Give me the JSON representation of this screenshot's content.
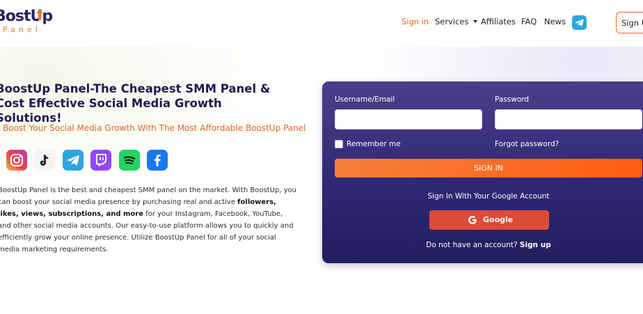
{
  "header": {
    "logo": {
      "main_text": "BostUp",
      "sub_text": "Panel"
    },
    "nav": {
      "signin": "Sign in",
      "services": "Services",
      "affiliates": "Affiliates",
      "faq": "FAQ",
      "news": "News"
    },
    "telegram_icon": "telegram-icon",
    "signup_label": "Sign Up"
  },
  "hero": {
    "headline": "BoostUp Panel-The Cheapest SMM Panel & Cost Effective Social Media Growth Solutions!",
    "tagline": "Boost Your Social Media Growth With The Most Affordable BoostUp Panel",
    "social_icons": [
      "instagram-icon",
      "tiktok-icon",
      "telegram-icon",
      "twitch-icon",
      "spotify-icon",
      "facebook-icon"
    ],
    "description": {
      "part1": "BoostUp Panel is the best and cheapest SMM panel on the market. With BoostUp, you can boost your social media presence by purchasing real and active ",
      "bold": "followers, likes, views, subscriptions, and more",
      "part2": " for your Instagram, Facebook, YouTube, and other social media accounts. Our easy-to-use platform allows you to quickly and efficiently grow your online presence. Utilize BoostUp Panel for all of your social media marketing requirements."
    }
  },
  "login": {
    "username_label": "Username/Email",
    "username_value": "",
    "password_label": "Password",
    "password_value": "",
    "remember_label": "Remember me",
    "remember_checked": false,
    "forgot_label": "Forgot password?",
    "signin_label": "SIGN IN",
    "google_caption": "Sign In With Your Google Account",
    "google_label": "Google",
    "no_account_text": "Do not have an account?",
    "signup_link": "Sign up"
  },
  "colors": {
    "accent_orange": "#f0641e",
    "card_top": "#4b3f8a",
    "card_bottom": "#221e5e",
    "google_red": "#dd4b39",
    "telegram_blue": "#2ca5e0"
  }
}
